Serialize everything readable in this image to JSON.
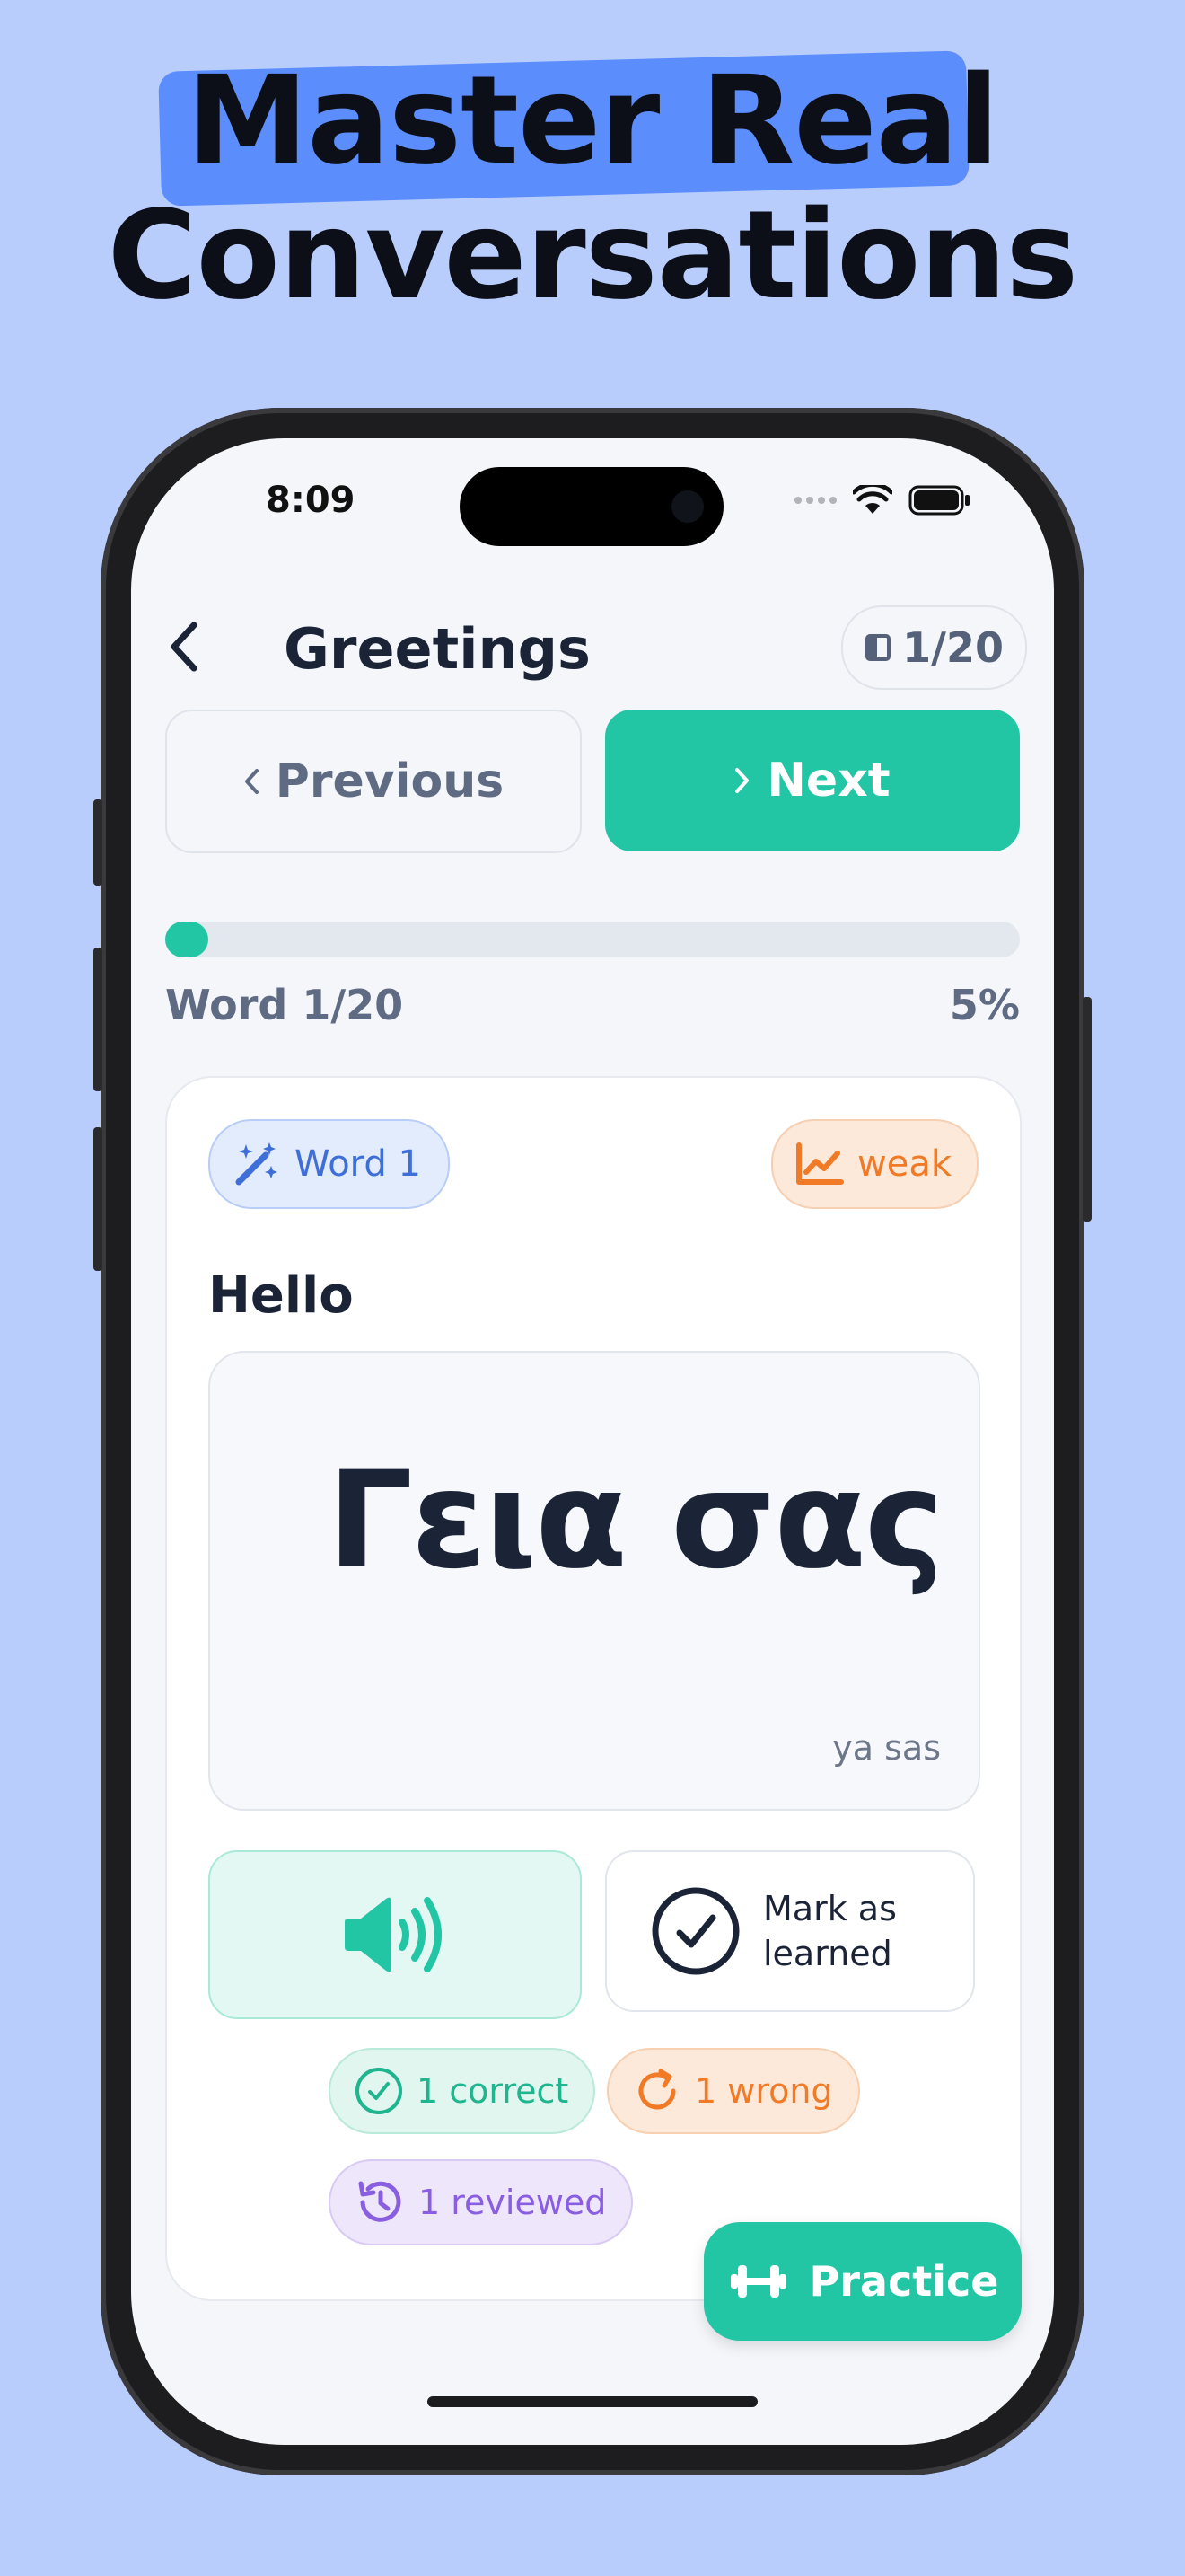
{
  "headline": {
    "line1": "Master Real",
    "line2": "Conversations"
  },
  "status_bar": {
    "time": "8:09"
  },
  "header": {
    "title": "Greetings",
    "counter": "1/20",
    "back_icon": "chevron-left-icon",
    "counter_icon": "book-icon"
  },
  "navigation": {
    "previous_label": "Previous",
    "next_label": "Next"
  },
  "progress": {
    "label": "Word 1/20",
    "percent_text": "5%",
    "fraction": 0.05
  },
  "card": {
    "word_badge": "Word 1",
    "strength_badge": "weak",
    "meaning": "Hello",
    "word": "Γεια σας",
    "transliteration": "ya sas",
    "mark_learned_label": "Mark as learned",
    "stats": {
      "correct": "1 correct",
      "wrong": "1 wrong",
      "reviewed": "1 reviewed"
    }
  },
  "practice_button": {
    "label": "Practice"
  },
  "colors": {
    "background": "#b9cdfd",
    "accent": "#22c6a5",
    "highlight": "#5b8efc",
    "weak_orange": "#f07a26",
    "reviewed_purple": "#8a5ee0",
    "word_blue": "#3e6fd8"
  }
}
